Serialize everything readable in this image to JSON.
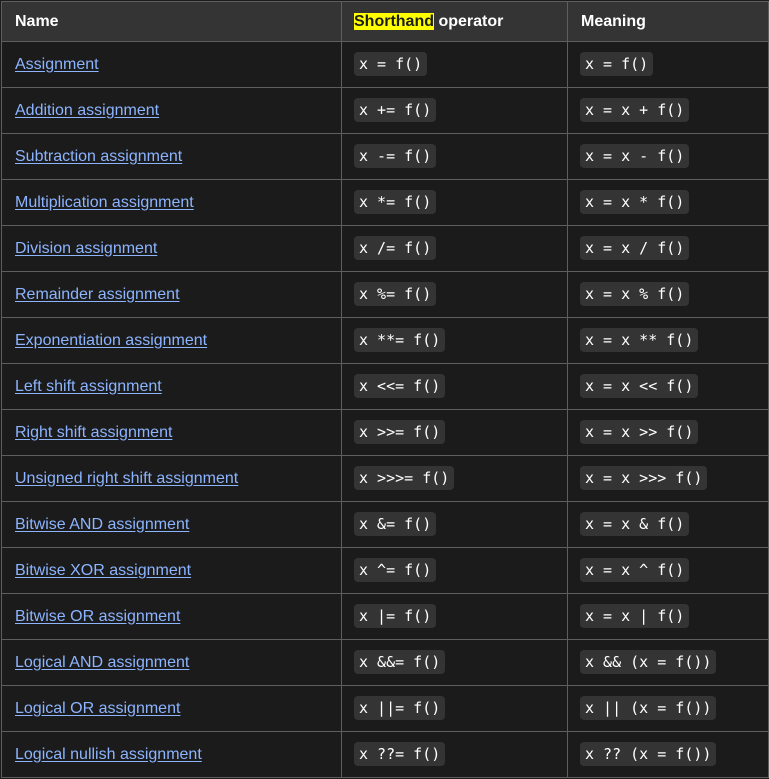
{
  "table": {
    "headers": {
      "name": "Name",
      "shorthand_highlight": "Shorthand",
      "shorthand_rest": " operator",
      "meaning": "Meaning"
    },
    "rows": [
      {
        "name": "Assignment",
        "shorthand": "x = f()",
        "meaning": "x = f()"
      },
      {
        "name": "Addition assignment",
        "shorthand": "x += f()",
        "meaning": "x = x + f()"
      },
      {
        "name": "Subtraction assignment",
        "shorthand": "x -= f()",
        "meaning": "x = x - f()"
      },
      {
        "name": "Multiplication assignment",
        "shorthand": "x *= f()",
        "meaning": "x = x * f()"
      },
      {
        "name": "Division assignment",
        "shorthand": "x /= f()",
        "meaning": "x = x / f()"
      },
      {
        "name": "Remainder assignment",
        "shorthand": "x %= f()",
        "meaning": "x = x % f()"
      },
      {
        "name": "Exponentiation assignment",
        "shorthand": "x **= f()",
        "meaning": "x = x ** f()"
      },
      {
        "name": "Left shift assignment",
        "shorthand": "x <<= f()",
        "meaning": "x = x << f()"
      },
      {
        "name": "Right shift assignment",
        "shorthand": "x >>= f()",
        "meaning": "x = x >> f()"
      },
      {
        "name": "Unsigned right shift assignment",
        "shorthand": "x >>>= f()",
        "meaning": "x = x >>> f()"
      },
      {
        "name": "Bitwise AND assignment",
        "shorthand": "x &= f()",
        "meaning": "x = x & f()"
      },
      {
        "name": "Bitwise XOR assignment",
        "shorthand": "x ^= f()",
        "meaning": "x = x ^ f()"
      },
      {
        "name": "Bitwise OR assignment",
        "shorthand": "x |= f()",
        "meaning": "x = x | f()"
      },
      {
        "name": "Logical AND assignment",
        "shorthand": "x &&= f()",
        "meaning": "x && (x = f())"
      },
      {
        "name": "Logical OR assignment",
        "shorthand": "x ||= f()",
        "meaning": "x || (x = f())"
      },
      {
        "name": "Logical nullish assignment",
        "shorthand": "x ??= f()",
        "meaning": "x ?? (x = f())"
      }
    ]
  }
}
